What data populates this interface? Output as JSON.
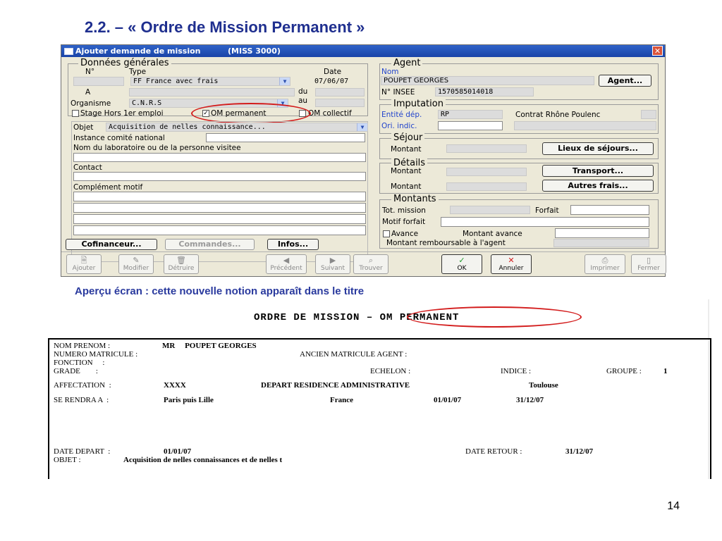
{
  "slide_title": "2.2. – « Ordre de Mission Permanent »",
  "window": {
    "title": "Ajouter demande de mission",
    "code": "(MISS 3000)",
    "close_symbol": "✕",
    "donnees": {
      "title": "Données générales",
      "no_label": "N°",
      "type_label": "Type",
      "type_value": "FF France avec frais",
      "date_label": "Date",
      "date_value": "07/06/07",
      "a_label": "A",
      "du_label": "du",
      "au_label": "au",
      "organisme_label": "Organisme",
      "organisme_value": "C.N.R.S",
      "stage_label": "Stage Hors 1er emploi",
      "om_permanent_label": "OM permanent",
      "om_collectif_label": "OM collectif",
      "objet_label": "Objet",
      "objet_value": "Acquisition de nelles connaissance...",
      "instance_label": "Instance comité national",
      "labo_label": "Nom du laboratoire ou de la personne visitee",
      "contact_label": "Contact",
      "complement_label": "Complément motif"
    },
    "buttons_left": {
      "cofinanceur": "Cofinanceur...",
      "commandes": "Commandes...",
      "infos": "Infos..."
    },
    "agent": {
      "title": "Agent",
      "nom_label": "Nom",
      "nom_value": "POUPET GEORGES",
      "agent_button": "Agent...",
      "insee_label": "N° INSEE",
      "insee_value": "1570585014018"
    },
    "imputation": {
      "title": "Imputation",
      "entite_label": "Entité dép.",
      "entite_value": "RP",
      "contrat_value": "Contrat Rhône Poulenc",
      "ori_label": "Ori. indic."
    },
    "sejour": {
      "title": "Séjour",
      "montant_label": "Montant",
      "lieux_button": "Lieux de séjours..."
    },
    "details": {
      "title": "Détails",
      "montant_label": "Montant",
      "transport_button": "Transport...",
      "montant2_label": "Montant",
      "autres_button": "Autres frais..."
    },
    "montants": {
      "title": "Montants",
      "tot_label": "Tot. mission",
      "forfait_label": "Forfait",
      "motif_label": "Motif forfait",
      "avance_label": "Avance",
      "montant_avance_label": "Montant avance",
      "remboursable_label": "Montant remboursable à l'agent"
    },
    "toolbar": {
      "ajouter": "Ajouter",
      "modifier": "Modifier",
      "detruire": "Détruire",
      "precedent": "Précédent",
      "suivant": "Suivant",
      "trouver": "Trouver",
      "ok": "OK",
      "annuler": "Annuler",
      "imprimer": "Imprimer",
      "fermer": "Fermer"
    }
  },
  "caption": "Aperçu écran : cette nouvelle notion apparaît dans le titre",
  "document": {
    "title_prefix": "ORDRE DE MISSION",
    "title_sep": "–",
    "title_suffix": "OM PERMANENT",
    "nom_prenom_label": "NOM PRENOM :",
    "nom_prenom_value": "MR     POUPET GEORGES",
    "matricule_label": "NUMERO MATRICULE :",
    "ancien_label": "ANCIEN MATRICULE AGENT :",
    "fonction_label": "FONCTION     :",
    "grade_label": "GRADE        :",
    "echelon_label": "ECHELON :",
    "indice_label": "INDICE :",
    "groupe_label": "GROUPE :",
    "groupe_value": "1",
    "affectation_label": "AFFECTATION  :",
    "affectation_value": "XXXX",
    "depart_residence_label": "DEPART RESIDENCE ADMINISTRATIVE",
    "depart_residence_value": "Toulouse",
    "se_rendra_label": "SE RENDRA A  :",
    "se_rendra_value": "Paris puis Lille",
    "pays_value": "France",
    "date_debut": "01/01/07",
    "date_fin": "31/12/07",
    "date_depart_label": "DATE DEPART  :",
    "date_depart_value": "01/01/07",
    "date_retour_label": "DATE RETOUR :",
    "date_retour_value": "31/12/07",
    "objet_label": "OBJET :",
    "objet_value": "Acquisition de nelles connaissances et de nelles t"
  },
  "page_number": "14",
  "colors": {
    "title_blue": "#1f2f8f",
    "caption_blue": "#2a3a9e",
    "highlight_red": "#d31c1c",
    "window_title_blue": "#1a44a8"
  }
}
